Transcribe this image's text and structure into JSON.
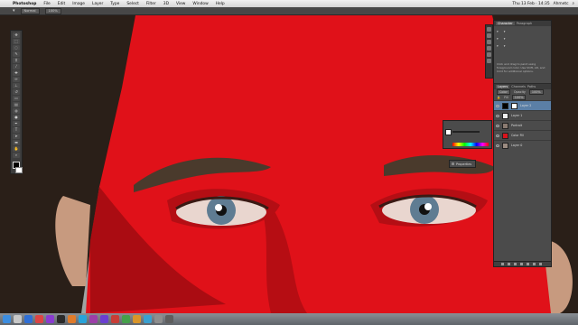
{
  "menubar": {
    "app": "Photoshop",
    "menus": [
      "File",
      "Edit",
      "Image",
      "Layer",
      "Type",
      "Select",
      "Filter",
      "3D",
      "View",
      "Window",
      "Help"
    ],
    "clock": "Thu 13 Feb · 14:35",
    "user": "Ahmetc"
  },
  "options": {
    "mode_label": "Normal",
    "opacity_label": "100%"
  },
  "dock": {
    "tabs": [
      "Character",
      "Paragraph"
    ],
    "layers_tabs": [
      "Layers",
      "Channels",
      "Paths"
    ],
    "blend_mode": "Color",
    "opacity_label": "Opacity",
    "opacity_value": "100%",
    "fill_label": "Fill",
    "fill_value": "100%",
    "note": "Click and drag to paint using foreground color. Use Shift, Alt, and Cmd for additional options.",
    "layers": [
      {
        "name": "Layer 2",
        "thumb": "#ffffff",
        "selected": true
      },
      {
        "name": "Layer 1",
        "thumb": "#eeeeee",
        "selected": false
      },
      {
        "name": "Portrait",
        "thumb": "#8a7a70",
        "selected": false
      },
      {
        "name": "Color Fill",
        "thumb": "#d8141c",
        "selected": false
      },
      {
        "name": "Layer 0",
        "thumb": "#9a8a80",
        "selected": false
      }
    ]
  },
  "colors": {
    "face_red": "#e01119",
    "hair": "#2a1f18",
    "bg": "#9ea4a3",
    "iris": "#5f7c92"
  },
  "properties_label": "Properties"
}
